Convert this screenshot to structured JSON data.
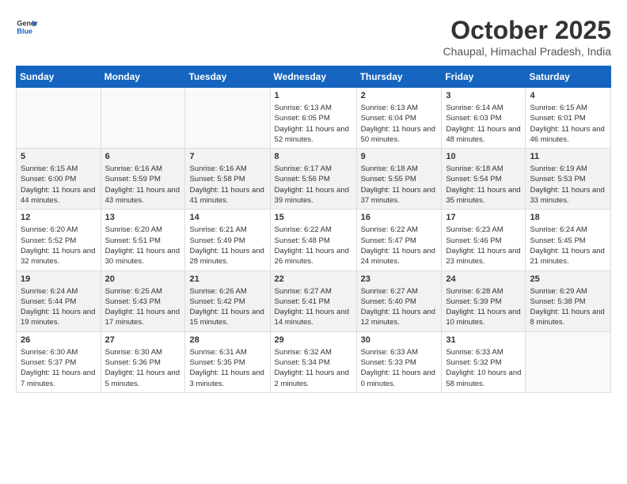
{
  "header": {
    "logo_general": "General",
    "logo_blue": "Blue",
    "month_title": "October 2025",
    "location": "Chaupal, Himachal Pradesh, India"
  },
  "weekdays": [
    "Sunday",
    "Monday",
    "Tuesday",
    "Wednesday",
    "Thursday",
    "Friday",
    "Saturday"
  ],
  "weeks": [
    [
      {
        "day": "",
        "info": ""
      },
      {
        "day": "",
        "info": ""
      },
      {
        "day": "",
        "info": ""
      },
      {
        "day": "1",
        "info": "Sunrise: 6:13 AM\nSunset: 6:05 PM\nDaylight: 11 hours and 52 minutes."
      },
      {
        "day": "2",
        "info": "Sunrise: 6:13 AM\nSunset: 6:04 PM\nDaylight: 11 hours and 50 minutes."
      },
      {
        "day": "3",
        "info": "Sunrise: 6:14 AM\nSunset: 6:03 PM\nDaylight: 11 hours and 48 minutes."
      },
      {
        "day": "4",
        "info": "Sunrise: 6:15 AM\nSunset: 6:01 PM\nDaylight: 11 hours and 46 minutes."
      }
    ],
    [
      {
        "day": "5",
        "info": "Sunrise: 6:15 AM\nSunset: 6:00 PM\nDaylight: 11 hours and 44 minutes."
      },
      {
        "day": "6",
        "info": "Sunrise: 6:16 AM\nSunset: 5:59 PM\nDaylight: 11 hours and 43 minutes."
      },
      {
        "day": "7",
        "info": "Sunrise: 6:16 AM\nSunset: 5:58 PM\nDaylight: 11 hours and 41 minutes."
      },
      {
        "day": "8",
        "info": "Sunrise: 6:17 AM\nSunset: 5:56 PM\nDaylight: 11 hours and 39 minutes."
      },
      {
        "day": "9",
        "info": "Sunrise: 6:18 AM\nSunset: 5:55 PM\nDaylight: 11 hours and 37 minutes."
      },
      {
        "day": "10",
        "info": "Sunrise: 6:18 AM\nSunset: 5:54 PM\nDaylight: 11 hours and 35 minutes."
      },
      {
        "day": "11",
        "info": "Sunrise: 6:19 AM\nSunset: 5:53 PM\nDaylight: 11 hours and 33 minutes."
      }
    ],
    [
      {
        "day": "12",
        "info": "Sunrise: 6:20 AM\nSunset: 5:52 PM\nDaylight: 11 hours and 32 minutes."
      },
      {
        "day": "13",
        "info": "Sunrise: 6:20 AM\nSunset: 5:51 PM\nDaylight: 11 hours and 30 minutes."
      },
      {
        "day": "14",
        "info": "Sunrise: 6:21 AM\nSunset: 5:49 PM\nDaylight: 11 hours and 28 minutes."
      },
      {
        "day": "15",
        "info": "Sunrise: 6:22 AM\nSunset: 5:48 PM\nDaylight: 11 hours and 26 minutes."
      },
      {
        "day": "16",
        "info": "Sunrise: 6:22 AM\nSunset: 5:47 PM\nDaylight: 11 hours and 24 minutes."
      },
      {
        "day": "17",
        "info": "Sunrise: 6:23 AM\nSunset: 5:46 PM\nDaylight: 11 hours and 23 minutes."
      },
      {
        "day": "18",
        "info": "Sunrise: 6:24 AM\nSunset: 5:45 PM\nDaylight: 11 hours and 21 minutes."
      }
    ],
    [
      {
        "day": "19",
        "info": "Sunrise: 6:24 AM\nSunset: 5:44 PM\nDaylight: 11 hours and 19 minutes."
      },
      {
        "day": "20",
        "info": "Sunrise: 6:25 AM\nSunset: 5:43 PM\nDaylight: 11 hours and 17 minutes."
      },
      {
        "day": "21",
        "info": "Sunrise: 6:26 AM\nSunset: 5:42 PM\nDaylight: 11 hours and 15 minutes."
      },
      {
        "day": "22",
        "info": "Sunrise: 6:27 AM\nSunset: 5:41 PM\nDaylight: 11 hours and 14 minutes."
      },
      {
        "day": "23",
        "info": "Sunrise: 6:27 AM\nSunset: 5:40 PM\nDaylight: 11 hours and 12 minutes."
      },
      {
        "day": "24",
        "info": "Sunrise: 6:28 AM\nSunset: 5:39 PM\nDaylight: 11 hours and 10 minutes."
      },
      {
        "day": "25",
        "info": "Sunrise: 6:29 AM\nSunset: 5:38 PM\nDaylight: 11 hours and 8 minutes."
      }
    ],
    [
      {
        "day": "26",
        "info": "Sunrise: 6:30 AM\nSunset: 5:37 PM\nDaylight: 11 hours and 7 minutes."
      },
      {
        "day": "27",
        "info": "Sunrise: 6:30 AM\nSunset: 5:36 PM\nDaylight: 11 hours and 5 minutes."
      },
      {
        "day": "28",
        "info": "Sunrise: 6:31 AM\nSunset: 5:35 PM\nDaylight: 11 hours and 3 minutes."
      },
      {
        "day": "29",
        "info": "Sunrise: 6:32 AM\nSunset: 5:34 PM\nDaylight: 11 hours and 2 minutes."
      },
      {
        "day": "30",
        "info": "Sunrise: 6:33 AM\nSunset: 5:33 PM\nDaylight: 11 hours and 0 minutes."
      },
      {
        "day": "31",
        "info": "Sunrise: 6:33 AM\nSunset: 5:32 PM\nDaylight: 10 hours and 58 minutes."
      },
      {
        "day": "",
        "info": ""
      }
    ]
  ]
}
